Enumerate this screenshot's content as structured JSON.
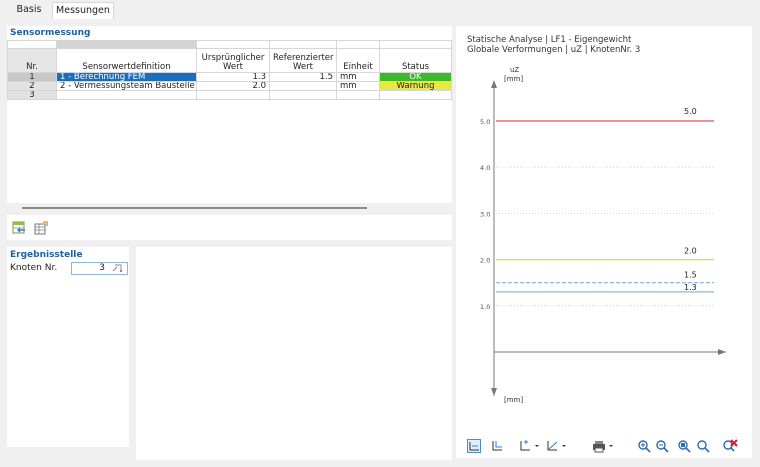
{
  "tabs": [
    {
      "label": "Basis",
      "active": false
    },
    {
      "label": "Messungen",
      "active": true
    }
  ],
  "sensor": {
    "section_title": "Sensormessung",
    "columns": {
      "nr": "Nr.",
      "definition": "Sensorwertdefinition",
      "original_1": "Ursprünglicher",
      "original_2": "Wert",
      "referenced_1": "Referenzierter",
      "referenced_2": "Wert",
      "unit": "Einheit",
      "status": "Status"
    },
    "rows": [
      {
        "nr": "1",
        "definition": "1 - Berechnung FEM",
        "original": "1.3",
        "referenced": "1.5",
        "unit": "mm",
        "status": "OK"
      },
      {
        "nr": "2",
        "definition": "2 - Vermessungsteam Baustelle",
        "original": "2.0",
        "referenced": "",
        "unit": "mm",
        "status": "Warnung"
      },
      {
        "nr": "3",
        "definition": "",
        "original": "",
        "referenced": "",
        "unit": "",
        "status": ""
      }
    ],
    "status_colors": {
      "ok": "#3cb82c",
      "warning": "#e8e840"
    }
  },
  "table_tools": {
    "icons": [
      "import-table-icon",
      "export-table-icon"
    ]
  },
  "ergebnis": {
    "section_title": "Ergebnisstelle",
    "knoten_label": "Knoten Nr.",
    "knoten_value": "3"
  },
  "chart_title": {
    "line1": "Statische Analyse | LF1 - Eigengewicht",
    "line2": "Globale Verformungen | uZ | KnotenNr. 3"
  },
  "chart_data": {
    "type": "line",
    "ylabel": "uZ",
    "yunit_top": "[mm]",
    "yunit_bottom": "[mm]",
    "ylim": [
      0,
      5.5
    ],
    "yticks": [
      {
        "value": 5.0,
        "label": "5.0"
      },
      {
        "value": 4.0,
        "label": "4.0"
      },
      {
        "value": 3.0,
        "label": "3.0"
      },
      {
        "value": 2.0,
        "label": "2.0"
      },
      {
        "value": 1.0,
        "label": "1.0"
      }
    ],
    "grid": true,
    "series": [
      {
        "value": 5.0,
        "label": "5.0",
        "color": "#e84c4c",
        "dashed": false
      },
      {
        "value": 2.0,
        "label": "2.0",
        "color": "#e8d820",
        "dashed": false
      },
      {
        "value": 1.5,
        "label": "1.5",
        "color": "#7ab0e0",
        "dashed": true
      },
      {
        "value": 1.3,
        "label": "1.3",
        "color": "#7ab0e0",
        "dashed": false
      }
    ]
  },
  "chart_tools": {
    "icons": [
      "chart-toggle-icon",
      "chart-axis-icon",
      "axis-options-icon",
      "line-options-icon",
      "print-icon",
      "zoom-in-icon",
      "zoom-out-icon",
      "zoom-fit-icon",
      "zoom-reset-icon",
      "clear-zoom-icon"
    ]
  }
}
